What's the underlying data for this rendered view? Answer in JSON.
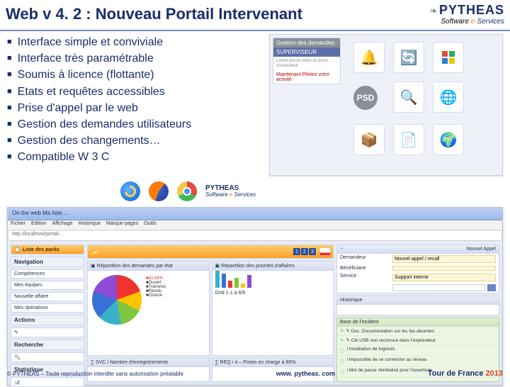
{
  "header": {
    "title": "Web v 4. 2 : Nouveau Portail Intervenant",
    "logo_brand": "PYTHEAS",
    "logo_sw": "Software",
    "logo_amp": "e-",
    "logo_sv": "Services"
  },
  "bullets": {
    "b1": "Interface simple et conviviale",
    "b2": "Interface très paramétrable",
    "b3": "Soumis à licence (flottante)",
    "b4": "Etats et requêtes accessibles",
    "b5": "Prise d'appel par le web",
    "b6": "Gestion des demandes utilisateurs",
    "b7": "Gestion des changements…",
    "b8": "Compatible W 3 C"
  },
  "top_screenshot": {
    "grey_title": "Gestion des demandes",
    "role": "SUPERVISEUR",
    "red_notice": "Maintenant Pilotez votre activité",
    "psd": "PSD"
  },
  "plogo": {
    "brand": "PYTHEAS",
    "sw": "Software",
    "amp": "e",
    "sv": "Services"
  },
  "dashboard": {
    "window_title": "On the web Ma liste ...",
    "menus": {
      "m1": "Fichier",
      "m2": "Edition",
      "m3": "Affichage",
      "m4": "Historique",
      "m5": "Marque-pages",
      "m6": "Outils"
    },
    "tab_active": "Liste des packs ",
    "side": {
      "nav": "Navigation",
      "n1": "Compétences",
      "n2": "Mes équipes",
      "n3": "Nouvelle affaire",
      "n4": "Mes opérations",
      "n5": "Actions",
      "n6": "Recherche",
      "n7": "Statistique",
      "cat1": "Navigation",
      "cat2": "Actions",
      "cat3": "Recherche",
      "cat4": "Statistique"
    },
    "mid": {
      "h1": "Répartition des demandes par état",
      "h2": "Répartition des priorités d'affaires",
      "pct_lbl": "42,84%",
      "leg_open": "Ouvert",
      "leg_trans": "Transmis",
      "leg_res": "Résolu",
      "leg_clos": "Cloturé",
      "h3": "∑ SVC / Nombre d'enregistrements",
      "h4": "∑ REQ / 4 – Prises en charge à 90%",
      "grid": "Grid 1-1 à 6/6",
      "pg1": "1",
      "pg2": "2",
      "pg3": "3"
    },
    "right": {
      "h1": "Nouvel Appel",
      "lbl_demandeur": "Demandeur",
      "val_demandeur": "Nouvel appel / recall",
      "lbl_beneficiaire": "Bénéficiaire",
      "val_beneficiaire": "",
      "lbl_service": "Service",
      "val_service": "Support interne",
      "h2": "Historique",
      "h3": "Base de l'incident",
      "k1": "✎  Doc. Documentation sur les fax-deumtes",
      "k2": "✎  Clé USB non reconnue dans l'explorateur",
      "k3": "i   Installation de logiciels",
      "k4": "i   Impossible de se connecter au réseau",
      "k5": "i   Mot de passe réinitialisé pour l'ouverture"
    }
  },
  "footer": {
    "copy": "© PYTHEAS – Toute reproduction interdite sans autorisation préalable",
    "url": "www. pytheas. com",
    "tour": "Tour de France ",
    "year": "2013"
  }
}
